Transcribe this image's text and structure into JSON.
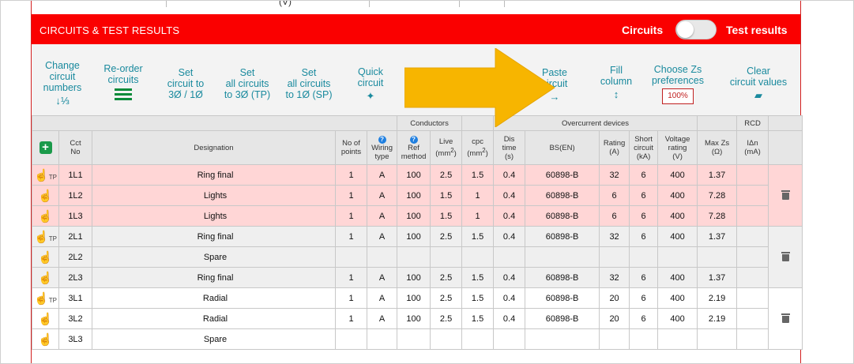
{
  "top_strip": {
    "unit": "(V)"
  },
  "header": {
    "title": "CIRCUITS & TEST RESULTS",
    "toggle_left": "Circuits",
    "toggle_right": "Test results",
    "colors": {
      "bar": "#fa0000",
      "tool_text": "#1a8a9e",
      "highlight_row": "#ffd6d6",
      "arrow": "#f7b500"
    }
  },
  "toolbar": {
    "change_numbers": [
      "Change",
      "circuit",
      "numbers"
    ],
    "change_numbers_icon": "↓⅓",
    "reorder": [
      "Re-order",
      "circuits"
    ],
    "set_3_1": [
      "Set",
      "circuit to",
      "3Ø / 1Ø"
    ],
    "set_all_3": [
      "Set",
      "all circuits",
      "to 3Ø (TP)"
    ],
    "set_all_1": [
      "Set",
      "all circuits",
      "to 1Ø (SP)"
    ],
    "quick": [
      "Quick",
      "circuit"
    ],
    "paste": [
      "Paste",
      "circuit"
    ],
    "paste_icon": "→",
    "fill": [
      "Fill",
      "column"
    ],
    "fill_icon": "↕",
    "zs": [
      "Choose Zs",
      "preferences"
    ],
    "zs_pct": "100%",
    "clear": [
      "Clear",
      "circuit values"
    ]
  },
  "table": {
    "group_conductors": "Conductors",
    "group_overcurrent": "Overcurrent devices",
    "group_rcd": "RCD",
    "columns": {
      "cct": [
        "Cct",
        "No"
      ],
      "designation": "Designation",
      "points": [
        "No of",
        "points"
      ],
      "wiring": [
        "Wiring",
        "type"
      ],
      "ref": [
        "Ref",
        "method"
      ],
      "live": "Live",
      "cpc": "cpc",
      "mm2": "(mm",
      "dis": [
        "Dis",
        "time",
        "(s)"
      ],
      "bs": "BS(EN)",
      "rating": [
        "Rating",
        "(A)"
      ],
      "short": [
        "Short",
        "circuit",
        "(kA)"
      ],
      "voltage": [
        "Voltage",
        "rating",
        "(V)"
      ],
      "maxzs": [
        "Max Zs",
        "(Ω)"
      ],
      "idn": [
        "IΔn",
        "(mA)"
      ]
    },
    "tp_label": "TP",
    "rows": [
      {
        "cct": "1L1",
        "designation": "Ring final",
        "points": "1",
        "wiring": "A",
        "ref": "100",
        "live": "2.5",
        "cpc": "1.5",
        "dis": "0.4",
        "bs": "60898-B",
        "rating": "32",
        "short": "6",
        "voltage": "400",
        "maxzs": "1.37",
        "idn": ""
      },
      {
        "cct": "1L2",
        "designation": "Lights",
        "points": "1",
        "wiring": "A",
        "ref": "100",
        "live": "1.5",
        "cpc": "1",
        "dis": "0.4",
        "bs": "60898-B",
        "rating": "6",
        "short": "6",
        "voltage": "400",
        "maxzs": "7.28",
        "idn": ""
      },
      {
        "cct": "1L3",
        "designation": "Lights",
        "points": "1",
        "wiring": "A",
        "ref": "100",
        "live": "1.5",
        "cpc": "1",
        "dis": "0.4",
        "bs": "60898-B",
        "rating": "6",
        "short": "6",
        "voltage": "400",
        "maxzs": "7.28",
        "idn": ""
      },
      {
        "cct": "2L1",
        "designation": "Ring final",
        "points": "1",
        "wiring": "A",
        "ref": "100",
        "live": "2.5",
        "cpc": "1.5",
        "dis": "0.4",
        "bs": "60898-B",
        "rating": "32",
        "short": "6",
        "voltage": "400",
        "maxzs": "1.37",
        "idn": ""
      },
      {
        "cct": "2L2",
        "designation": "Spare",
        "points": "",
        "wiring": "",
        "ref": "",
        "live": "",
        "cpc": "",
        "dis": "",
        "bs": "",
        "rating": "",
        "short": "",
        "voltage": "",
        "maxzs": "",
        "idn": ""
      },
      {
        "cct": "2L3",
        "designation": "Ring final",
        "points": "1",
        "wiring": "A",
        "ref": "100",
        "live": "2.5",
        "cpc": "1.5",
        "dis": "0.4",
        "bs": "60898-B",
        "rating": "32",
        "short": "6",
        "voltage": "400",
        "maxzs": "1.37",
        "idn": ""
      },
      {
        "cct": "3L1",
        "designation": "Radial",
        "points": "1",
        "wiring": "A",
        "ref": "100",
        "live": "2.5",
        "cpc": "1.5",
        "dis": "0.4",
        "bs": "60898-B",
        "rating": "20",
        "short": "6",
        "voltage": "400",
        "maxzs": "2.19",
        "idn": ""
      },
      {
        "cct": "3L2",
        "designation": "Radial",
        "points": "1",
        "wiring": "A",
        "ref": "100",
        "live": "2.5",
        "cpc": "1.5",
        "dis": "0.4",
        "bs": "60898-B",
        "rating": "20",
        "short": "6",
        "voltage": "400",
        "maxzs": "2.19",
        "idn": ""
      },
      {
        "cct": "3L3",
        "designation": "Spare",
        "points": "",
        "wiring": "",
        "ref": "",
        "live": "",
        "cpc": "",
        "dis": "",
        "bs": "",
        "rating": "",
        "short": "",
        "voltage": "",
        "maxzs": "",
        "idn": ""
      }
    ]
  }
}
